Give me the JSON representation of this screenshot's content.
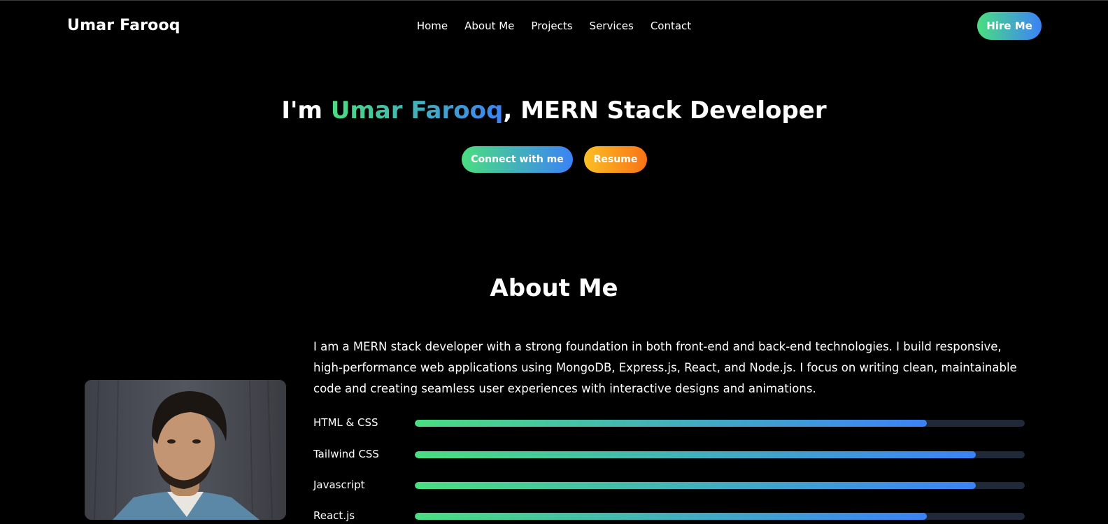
{
  "brand": "Umar Farooq",
  "nav": {
    "items": [
      "Home",
      "About Me",
      "Projects",
      "Services",
      "Contact"
    ],
    "hire_label": "Hire Me"
  },
  "hero": {
    "prefix": "I'm ",
    "name": "Umar Farooq",
    "suffix": ", MERN Stack Developer",
    "connect_label": "Connect with me",
    "resume_label": "Resume"
  },
  "about": {
    "heading": "About Me",
    "text": "I am a MERN stack developer with a strong foundation in both front-end and back-end technologies. I build responsive, high-performance web applications using MongoDB, Express.js, React, and Node.js. I focus on writing clean, maintainable code and creating seamless user experiences with interactive designs and animations.",
    "skills": [
      {
        "name": "HTML & CSS",
        "level": 0.84
      },
      {
        "name": "Tailwind CSS",
        "level": 0.92
      },
      {
        "name": "Javascript",
        "level": 0.92
      },
      {
        "name": "React.js",
        "level": 0.84
      }
    ]
  },
  "colors": {
    "accent_start": "#4ade80",
    "accent_end": "#3b82f6",
    "resume_start": "#fbbf24",
    "resume_end": "#f97316",
    "track": "#1f2937"
  }
}
